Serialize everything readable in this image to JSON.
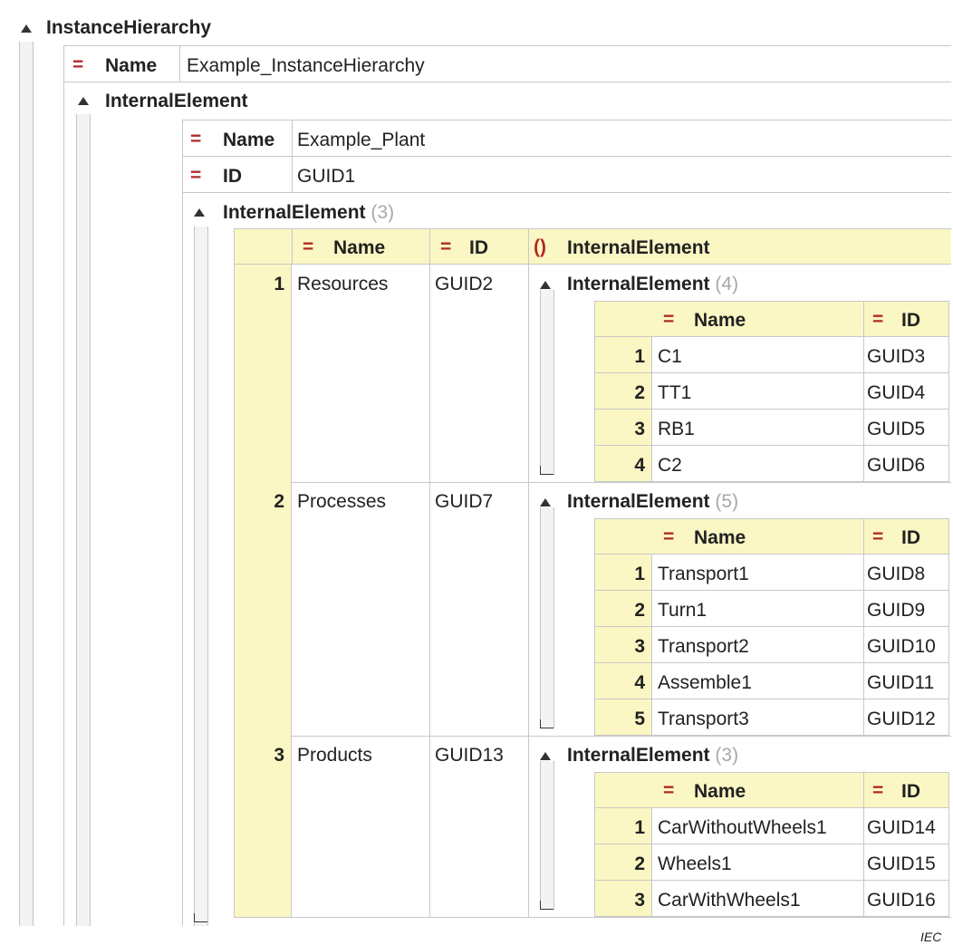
{
  "root": {
    "label": "InstanceHierarchy"
  },
  "root_attr": {
    "label": "Name",
    "value": "Example_InstanceHierarchy"
  },
  "ie": {
    "label": "InternalElement"
  },
  "ie_name": {
    "label": "Name",
    "value": "Example_Plant"
  },
  "ie_id": {
    "label": "ID",
    "value": "GUID1"
  },
  "ie_children": {
    "label": "InternalElement",
    "count": "(3)"
  },
  "table": {
    "col_name": "Name",
    "col_id": "ID",
    "col_ie": "InternalElement",
    "rows": [
      {
        "num": "1",
        "name": "Resources",
        "id": "GUID2",
        "sub_label": "InternalElement",
        "sub_count": "(4)",
        "sub_col_name": "Name",
        "sub_col_id": "ID",
        "items": [
          {
            "num": "1",
            "name": "C1",
            "id": "GUID3"
          },
          {
            "num": "2",
            "name": "TT1",
            "id": "GUID4"
          },
          {
            "num": "3",
            "name": "RB1",
            "id": "GUID5"
          },
          {
            "num": "4",
            "name": "C2",
            "id": "GUID6"
          }
        ]
      },
      {
        "num": "2",
        "name": "Processes",
        "id": "GUID7",
        "sub_label": "InternalElement",
        "sub_count": "(5)",
        "sub_col_name": "Name",
        "sub_col_id": "ID",
        "items": [
          {
            "num": "1",
            "name": "Transport1",
            "id": "GUID8"
          },
          {
            "num": "2",
            "name": "Turn1",
            "id": "GUID9"
          },
          {
            "num": "3",
            "name": "Transport2",
            "id": "GUID10"
          },
          {
            "num": "4",
            "name": "Assemble1",
            "id": "GUID11"
          },
          {
            "num": "5",
            "name": "Transport3",
            "id": "GUID12"
          }
        ]
      },
      {
        "num": "3",
        "name": "Products",
        "id": "GUID13",
        "sub_label": "InternalElement",
        "sub_count": "(3)",
        "sub_col_name": "Name",
        "sub_col_id": "ID",
        "items": [
          {
            "num": "1",
            "name": "CarWithoutWheels1",
            "id": "GUID14"
          },
          {
            "num": "2",
            "name": "Wheels1",
            "id": "GUID15"
          },
          {
            "num": "3",
            "name": "CarWithWheels1",
            "id": "GUID16"
          }
        ]
      }
    ]
  },
  "footer": {
    "credit": "IEC"
  },
  "colors": {
    "highlight": "#fbf7c4",
    "attr_icon": "#b02a2a",
    "count": "#a8a8a8"
  },
  "icons": {
    "expand": "collapse-triangle-icon",
    "attribute": "equals-attribute-icon",
    "element": "braces-element-icon"
  }
}
